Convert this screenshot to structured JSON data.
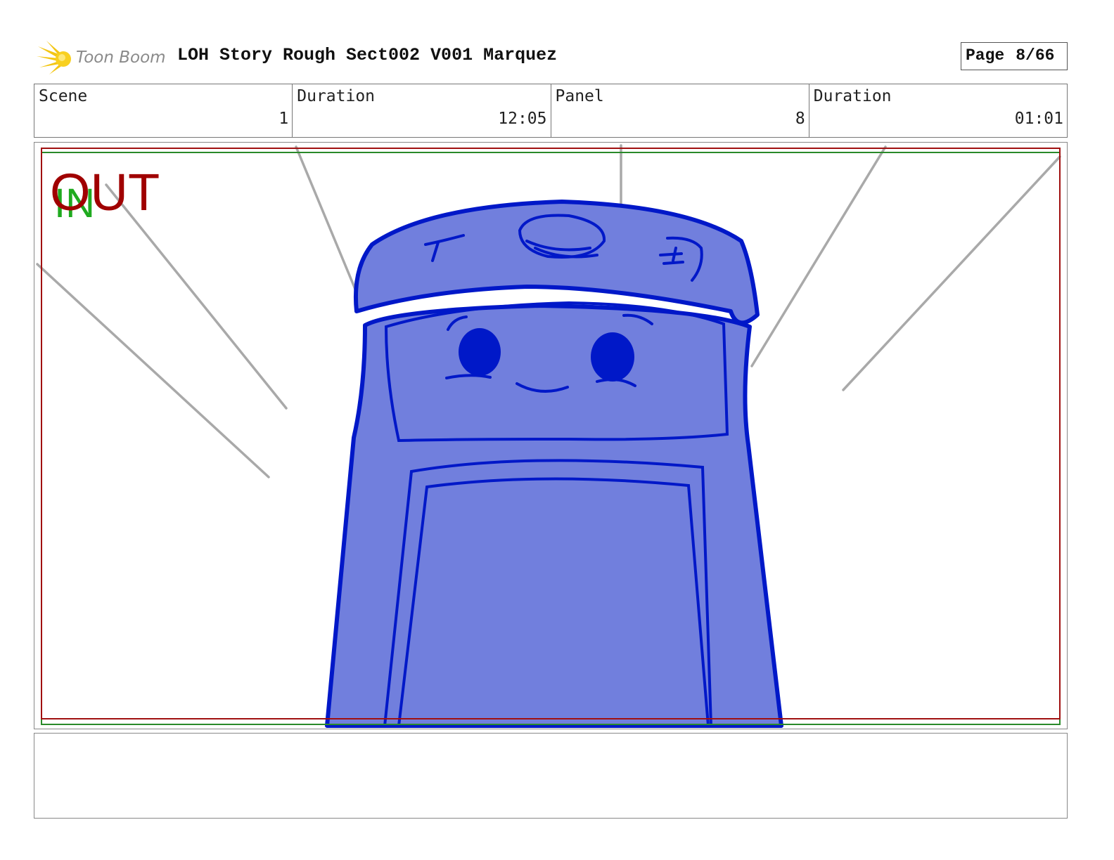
{
  "header": {
    "logo_text": "Toon Boom",
    "title": "LOH Story Rough Sect002 V001 Marquez",
    "page_label": "Page",
    "page_value": "8/66"
  },
  "info": {
    "scene_label": "Scene",
    "scene_value": "1",
    "scene_duration_label": "Duration",
    "scene_duration_value": "12:05",
    "panel_label": "Panel",
    "panel_value": "8",
    "panel_duration_label": "Duration",
    "panel_duration_value": "01:01"
  },
  "panel": {
    "in_marker": "IN",
    "out_marker": "OUT"
  },
  "colors": {
    "character_fill": "#717fdd",
    "character_line": "#0018c8",
    "speed_lines": "#a9a9a9",
    "safe_frame_red": "#a01010",
    "safe_frame_green": "#2a8a2a",
    "in_marker": "#1faa1f",
    "out_marker": "#a00000"
  }
}
